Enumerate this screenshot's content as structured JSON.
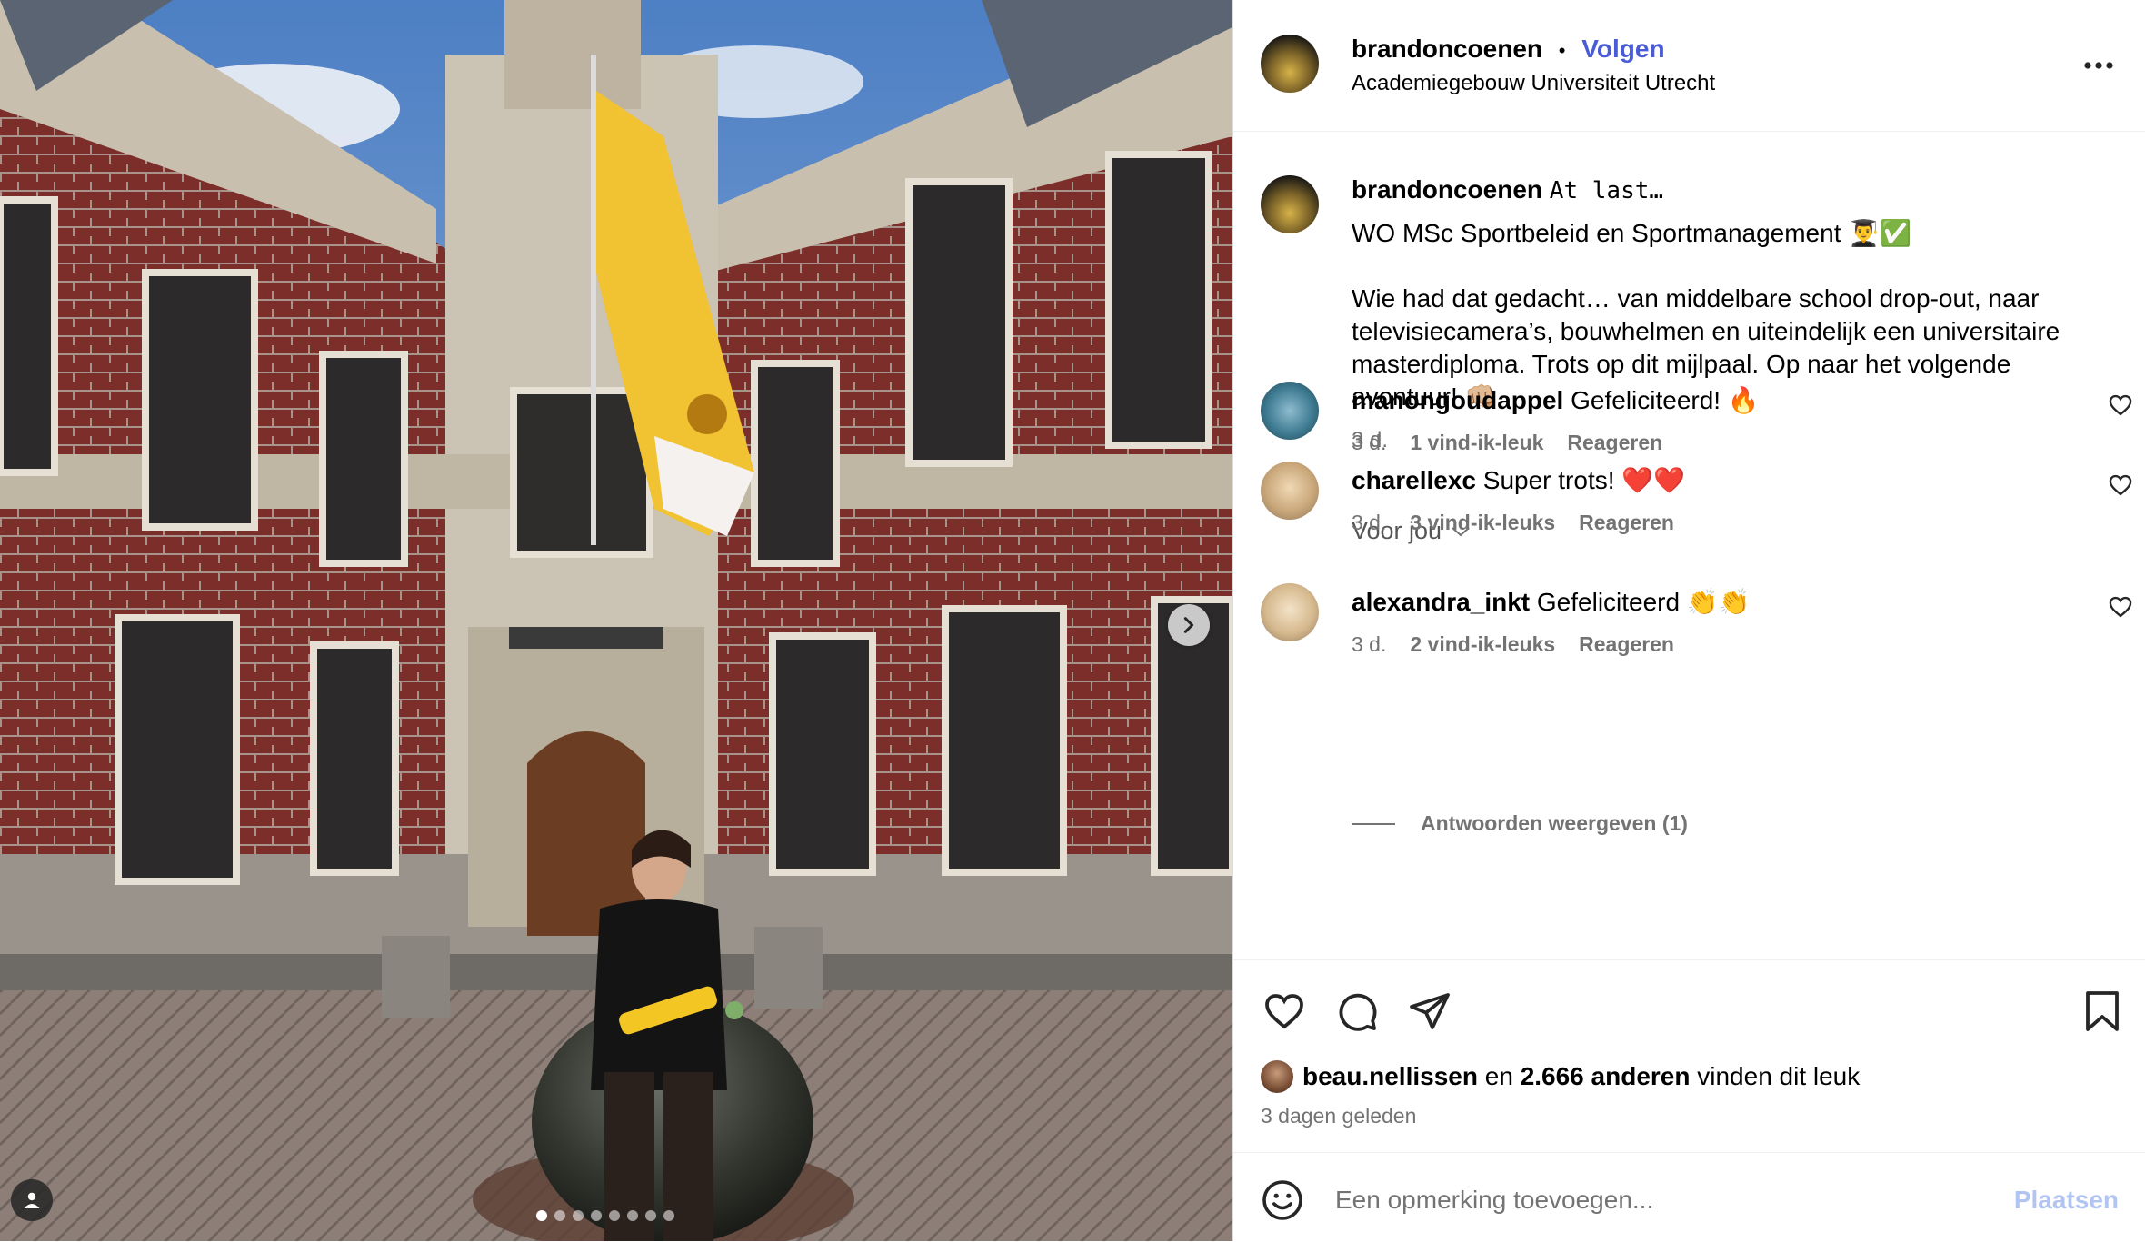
{
  "post": {
    "username": "brandoncoenen",
    "follow_label": "Volgen",
    "separator": "•",
    "location": "Academiegebouw Universiteit Utrecht",
    "more_label": "More options"
  },
  "caption": {
    "username": "brandoncoenen",
    "first_line": "At last…",
    "line2": "WO MSc Sportbeleid en Sportmanagement 👨‍🎓✅",
    "line3": "Wie had dat gedacht… van middelbare school drop-out, naar televisiecamera’s, bouwhelmen en uiteindelijk een universitaire masterdiploma. Trots op dit mijlpaal. Op naar het volgende avontuur! 👊🏼",
    "time": "3 d."
  },
  "for_you_label": "Voor jou",
  "comments": [
    {
      "username": "manongoudappel",
      "text": "Gefeliciteerd! 🔥",
      "time": "3 d.",
      "likes": "1 vind-ik-leuk",
      "reply": "Reageren"
    },
    {
      "username": "charellexc",
      "text": "Super trots! ❤️❤️",
      "time": "3 d.",
      "likes": "3 vind-ik-leuks",
      "reply": "Reageren"
    },
    {
      "username": "alexandra_inkt",
      "text": "Gefeliciteerd 👏👏",
      "time": "3 d.",
      "likes": "2 vind-ik-leuks",
      "reply": "Reageren"
    }
  ],
  "view_replies_label": "Antwoorden weergeven (1)",
  "likes_summary": {
    "user": "beau.nellissen",
    "connector": "en",
    "count": "2.666 anderen",
    "suffix": "vinden dit leuk"
  },
  "posted_ago": "3 dagen geleden",
  "comment_input": {
    "placeholder": "Een opmerking toevoegen...",
    "post_label": "Plaatsen"
  },
  "carousel": {
    "count": 8,
    "active_index": 0
  },
  "colors": {
    "follow": "#4a5bd6",
    "post_button_disabled": "#b2c5f2",
    "secondary_text": "#737373"
  }
}
